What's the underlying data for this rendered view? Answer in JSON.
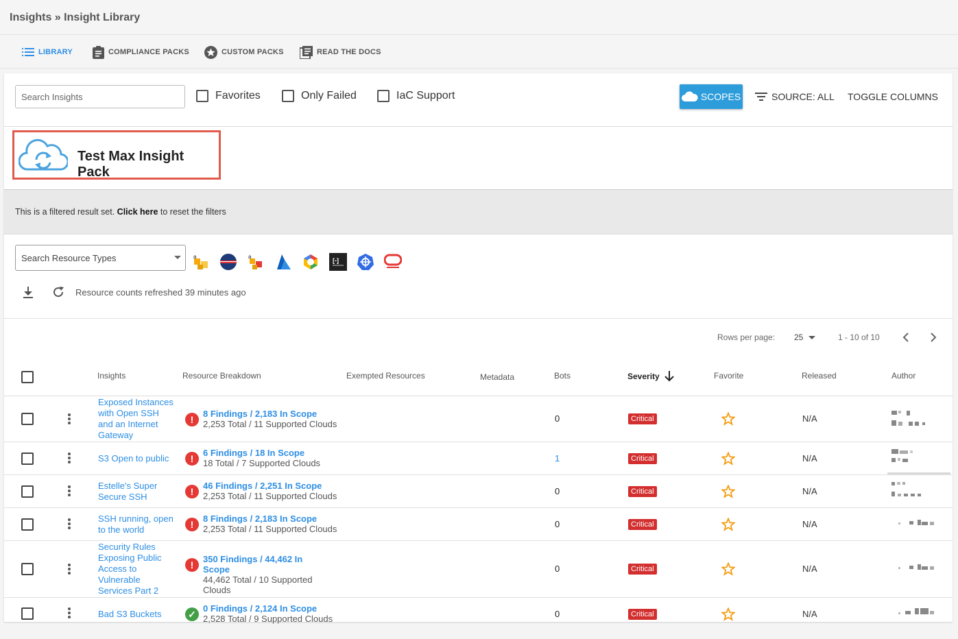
{
  "breadcrumb": "Insights » Insight Library",
  "nav": {
    "library": "LIBRARY",
    "compliance_packs": "COMPLIANCE PACKS",
    "custom_packs": "CUSTOM PACKS",
    "read_docs": "READ THE DOCS"
  },
  "toolbar": {
    "search_placeholder": "Search Insights",
    "favorites": "Favorites",
    "only_failed": "Only Failed",
    "iac_support": "IaC Support",
    "scopes": "SCOPES",
    "source": "SOURCE: ALL",
    "toggle_columns": "TOGGLE COLUMNS"
  },
  "pack": {
    "title": "Test Max Insight Pack"
  },
  "filter_banner": {
    "prefix": "This is a filtered result set. ",
    "link": "Click here",
    "suffix": " to reset the filters"
  },
  "resources": {
    "placeholder": "Search Resource Types",
    "refreshed": "Resource counts refreshed 39 minutes ago"
  },
  "pagination": {
    "rows_label": "Rows per page:",
    "rows_value": "25",
    "range": "1 - 10 of 10"
  },
  "columns": {
    "insights": "Insights",
    "resource_breakdown": "Resource Breakdown",
    "exempted": "Exempted Resources",
    "metadata": "Metadata",
    "bots": "Bots",
    "severity": "Severity",
    "favorite": "Favorite",
    "released": "Released",
    "author": "Author"
  },
  "rows": [
    {
      "name": "Exposed Instances with Open SSH and an Internet Gateway",
      "findings": "8 Findings / 2,183 In Scope",
      "total": "2,253 Total / 11 Supported Clouds",
      "bots": "0",
      "severity": "Critical",
      "released": "N/A"
    },
    {
      "name": "S3 Open to public",
      "findings": "6 Findings / 18 In Scope",
      "total": "18 Total / 7 Supported Clouds",
      "bots": "1",
      "severity": "Critical",
      "released": "N/A"
    },
    {
      "name": "Estelle's Super Secure SSH",
      "findings": "46 Findings / 2,251 In Scope",
      "total": "2,253 Total / 11 Supported Clouds",
      "bots": "0",
      "severity": "Critical",
      "released": "N/A"
    },
    {
      "name": "SSH running, open to the world",
      "findings": "8 Findings / 2,183 In Scope",
      "total": "2,253 Total / 11 Supported Clouds",
      "bots": "0",
      "severity": "Critical",
      "released": "N/A"
    },
    {
      "name": "Security Rules Exposing Public Access to Vulnerable Services Part 2",
      "findings": "350 Findings / 44,462 In Scope",
      "total": "44,462 Total / 10 Supported Clouds",
      "bots": "0",
      "severity": "Critical",
      "released": "N/A"
    },
    {
      "name": "Bad S3 Buckets",
      "findings": "0 Findings / 2,124 In Scope",
      "total": "2,528 Total / 9 Supported Clouds",
      "bots": "0",
      "severity": "Critical",
      "released": "N/A"
    }
  ]
}
